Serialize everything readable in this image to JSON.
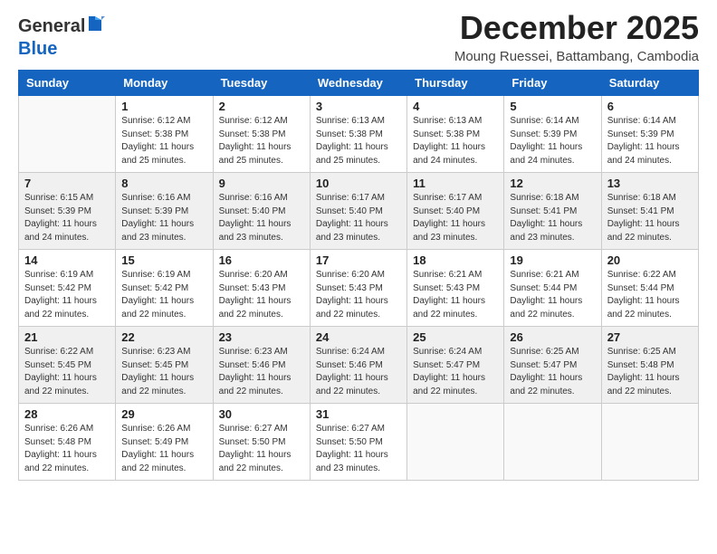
{
  "logo": {
    "general": "General",
    "blue": "Blue"
  },
  "title": "December 2025",
  "subtitle": "Moung Ruessei, Battambang, Cambodia",
  "weekdays": [
    "Sunday",
    "Monday",
    "Tuesday",
    "Wednesday",
    "Thursday",
    "Friday",
    "Saturday"
  ],
  "weeks": [
    [
      {
        "day": "",
        "sunrise": "",
        "sunset": "",
        "daylight": ""
      },
      {
        "day": "1",
        "sunrise": "Sunrise: 6:12 AM",
        "sunset": "Sunset: 5:38 PM",
        "daylight": "Daylight: 11 hours and 25 minutes."
      },
      {
        "day": "2",
        "sunrise": "Sunrise: 6:12 AM",
        "sunset": "Sunset: 5:38 PM",
        "daylight": "Daylight: 11 hours and 25 minutes."
      },
      {
        "day": "3",
        "sunrise": "Sunrise: 6:13 AM",
        "sunset": "Sunset: 5:38 PM",
        "daylight": "Daylight: 11 hours and 25 minutes."
      },
      {
        "day": "4",
        "sunrise": "Sunrise: 6:13 AM",
        "sunset": "Sunset: 5:38 PM",
        "daylight": "Daylight: 11 hours and 24 minutes."
      },
      {
        "day": "5",
        "sunrise": "Sunrise: 6:14 AM",
        "sunset": "Sunset: 5:39 PM",
        "daylight": "Daylight: 11 hours and 24 minutes."
      },
      {
        "day": "6",
        "sunrise": "Sunrise: 6:14 AM",
        "sunset": "Sunset: 5:39 PM",
        "daylight": "Daylight: 11 hours and 24 minutes."
      }
    ],
    [
      {
        "day": "7",
        "sunrise": "Sunrise: 6:15 AM",
        "sunset": "Sunset: 5:39 PM",
        "daylight": "Daylight: 11 hours and 24 minutes."
      },
      {
        "day": "8",
        "sunrise": "Sunrise: 6:16 AM",
        "sunset": "Sunset: 5:39 PM",
        "daylight": "Daylight: 11 hours and 23 minutes."
      },
      {
        "day": "9",
        "sunrise": "Sunrise: 6:16 AM",
        "sunset": "Sunset: 5:40 PM",
        "daylight": "Daylight: 11 hours and 23 minutes."
      },
      {
        "day": "10",
        "sunrise": "Sunrise: 6:17 AM",
        "sunset": "Sunset: 5:40 PM",
        "daylight": "Daylight: 11 hours and 23 minutes."
      },
      {
        "day": "11",
        "sunrise": "Sunrise: 6:17 AM",
        "sunset": "Sunset: 5:40 PM",
        "daylight": "Daylight: 11 hours and 23 minutes."
      },
      {
        "day": "12",
        "sunrise": "Sunrise: 6:18 AM",
        "sunset": "Sunset: 5:41 PM",
        "daylight": "Daylight: 11 hours and 23 minutes."
      },
      {
        "day": "13",
        "sunrise": "Sunrise: 6:18 AM",
        "sunset": "Sunset: 5:41 PM",
        "daylight": "Daylight: 11 hours and 22 minutes."
      }
    ],
    [
      {
        "day": "14",
        "sunrise": "Sunrise: 6:19 AM",
        "sunset": "Sunset: 5:42 PM",
        "daylight": "Daylight: 11 hours and 22 minutes."
      },
      {
        "day": "15",
        "sunrise": "Sunrise: 6:19 AM",
        "sunset": "Sunset: 5:42 PM",
        "daylight": "Daylight: 11 hours and 22 minutes."
      },
      {
        "day": "16",
        "sunrise": "Sunrise: 6:20 AM",
        "sunset": "Sunset: 5:43 PM",
        "daylight": "Daylight: 11 hours and 22 minutes."
      },
      {
        "day": "17",
        "sunrise": "Sunrise: 6:20 AM",
        "sunset": "Sunset: 5:43 PM",
        "daylight": "Daylight: 11 hours and 22 minutes."
      },
      {
        "day": "18",
        "sunrise": "Sunrise: 6:21 AM",
        "sunset": "Sunset: 5:43 PM",
        "daylight": "Daylight: 11 hours and 22 minutes."
      },
      {
        "day": "19",
        "sunrise": "Sunrise: 6:21 AM",
        "sunset": "Sunset: 5:44 PM",
        "daylight": "Daylight: 11 hours and 22 minutes."
      },
      {
        "day": "20",
        "sunrise": "Sunrise: 6:22 AM",
        "sunset": "Sunset: 5:44 PM",
        "daylight": "Daylight: 11 hours and 22 minutes."
      }
    ],
    [
      {
        "day": "21",
        "sunrise": "Sunrise: 6:22 AM",
        "sunset": "Sunset: 5:45 PM",
        "daylight": "Daylight: 11 hours and 22 minutes."
      },
      {
        "day": "22",
        "sunrise": "Sunrise: 6:23 AM",
        "sunset": "Sunset: 5:45 PM",
        "daylight": "Daylight: 11 hours and 22 minutes."
      },
      {
        "day": "23",
        "sunrise": "Sunrise: 6:23 AM",
        "sunset": "Sunset: 5:46 PM",
        "daylight": "Daylight: 11 hours and 22 minutes."
      },
      {
        "day": "24",
        "sunrise": "Sunrise: 6:24 AM",
        "sunset": "Sunset: 5:46 PM",
        "daylight": "Daylight: 11 hours and 22 minutes."
      },
      {
        "day": "25",
        "sunrise": "Sunrise: 6:24 AM",
        "sunset": "Sunset: 5:47 PM",
        "daylight": "Daylight: 11 hours and 22 minutes."
      },
      {
        "day": "26",
        "sunrise": "Sunrise: 6:25 AM",
        "sunset": "Sunset: 5:47 PM",
        "daylight": "Daylight: 11 hours and 22 minutes."
      },
      {
        "day": "27",
        "sunrise": "Sunrise: 6:25 AM",
        "sunset": "Sunset: 5:48 PM",
        "daylight": "Daylight: 11 hours and 22 minutes."
      }
    ],
    [
      {
        "day": "28",
        "sunrise": "Sunrise: 6:26 AM",
        "sunset": "Sunset: 5:48 PM",
        "daylight": "Daylight: 11 hours and 22 minutes."
      },
      {
        "day": "29",
        "sunrise": "Sunrise: 6:26 AM",
        "sunset": "Sunset: 5:49 PM",
        "daylight": "Daylight: 11 hours and 22 minutes."
      },
      {
        "day": "30",
        "sunrise": "Sunrise: 6:27 AM",
        "sunset": "Sunset: 5:50 PM",
        "daylight": "Daylight: 11 hours and 22 minutes."
      },
      {
        "day": "31",
        "sunrise": "Sunrise: 6:27 AM",
        "sunset": "Sunset: 5:50 PM",
        "daylight": "Daylight: 11 hours and 23 minutes."
      },
      {
        "day": "",
        "sunrise": "",
        "sunset": "",
        "daylight": ""
      },
      {
        "day": "",
        "sunrise": "",
        "sunset": "",
        "daylight": ""
      },
      {
        "day": "",
        "sunrise": "",
        "sunset": "",
        "daylight": ""
      }
    ]
  ]
}
